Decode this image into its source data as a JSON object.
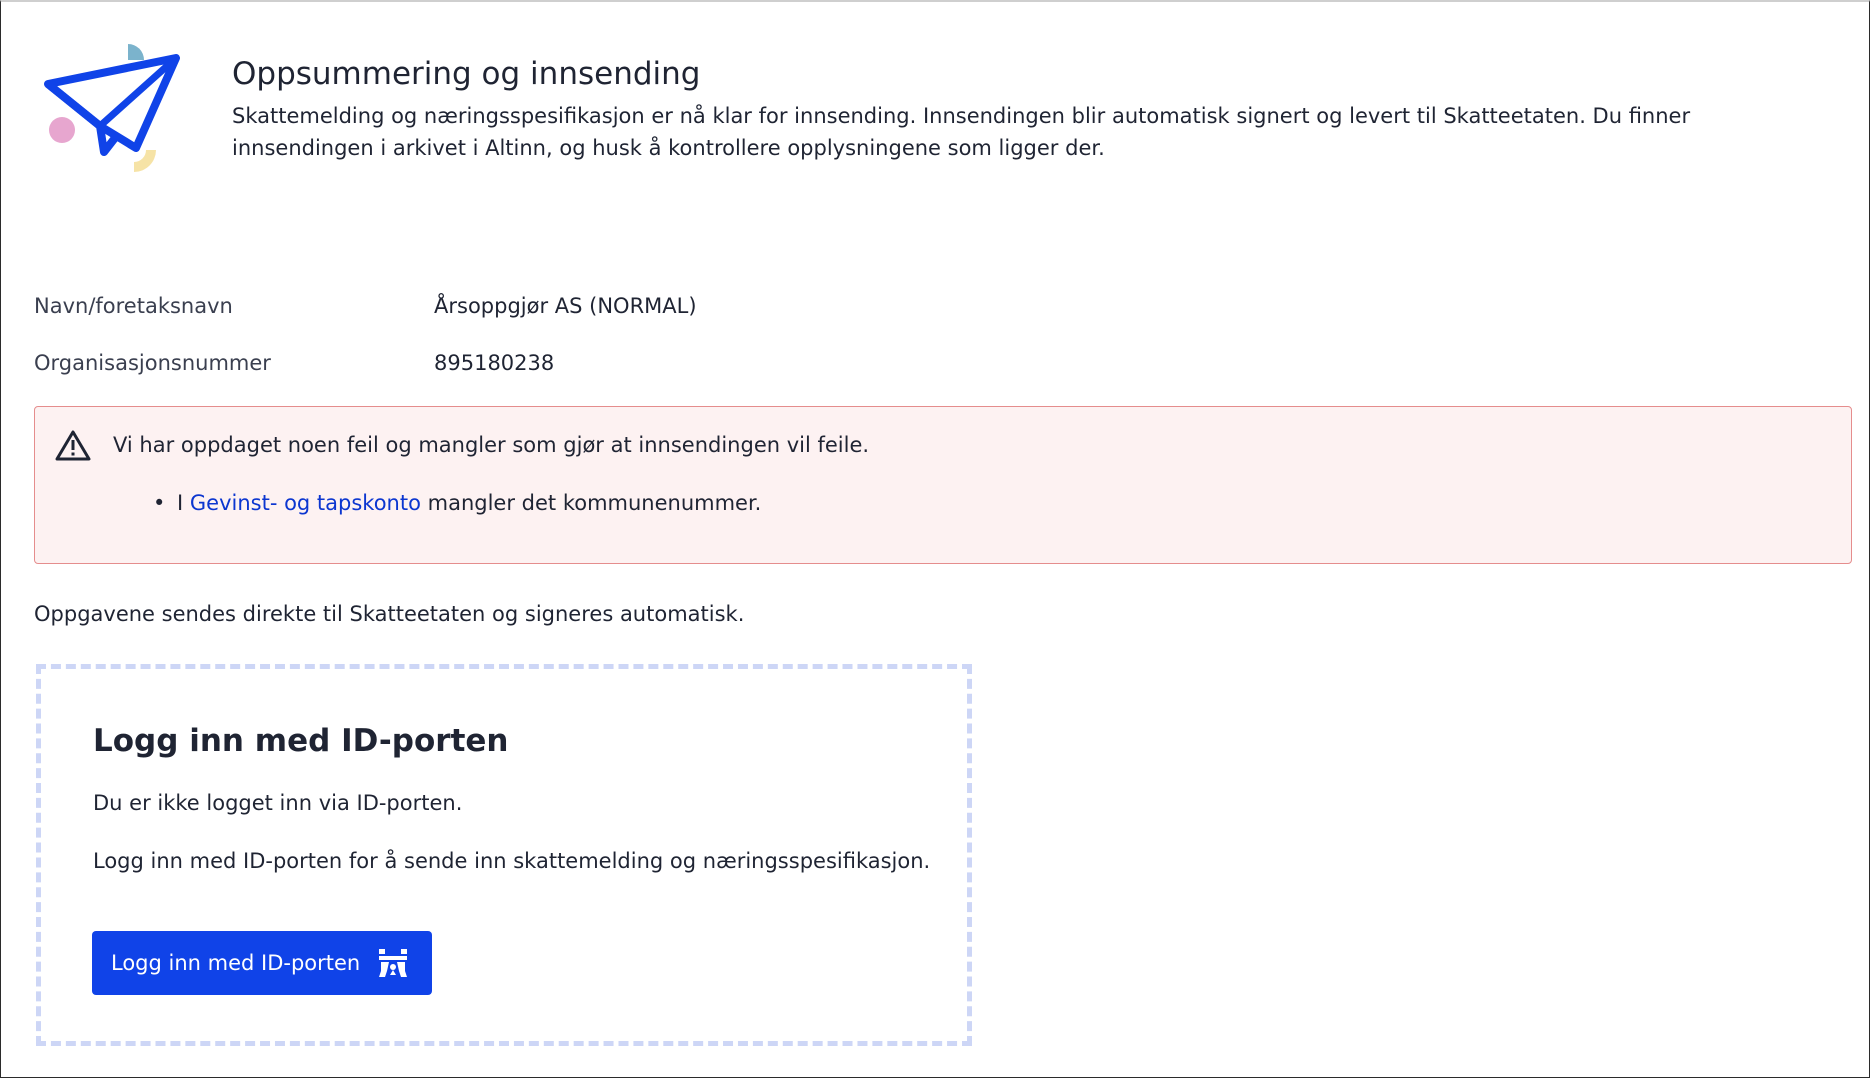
{
  "header": {
    "title": "Oppsummering og innsending",
    "intro": "Skattemelding og næringsspesifikasjon er nå klar for innsending. Innsendingen blir automatisk signert og levert til Skatteetaten. Du finner innsendingen i arkivet i Altinn, og husk å kontrollere opplysningene som ligger der.",
    "icon": "paper-plane-icon"
  },
  "info": {
    "name_label": "Navn/foretaksnavn",
    "name_value": "Årsoppgjør AS (NORMAL)",
    "orgnr_label": "Organisasjonsnummer",
    "orgnr_value": "895180238"
  },
  "alert": {
    "icon": "warning-icon",
    "message": "Vi har oppdaget noen feil og mangler som gjør at innsendingen vil feile.",
    "items": [
      {
        "prefix": "I ",
        "link": "Gevinst- og tapskonto",
        "suffix": " mangler det kommunenummer."
      }
    ],
    "colors": {
      "background": "#fdf2f2",
      "border": "#e58d8d",
      "link": "#0c36d0"
    }
  },
  "note": "Oppgavene sendes direkte til Skatteetaten og signeres automatisk.",
  "login": {
    "title": "Logg inn med ID-porten",
    "p1": "Du er ikke logget inn via ID-porten.",
    "p2": "Logg inn med ID-porten for å sende inn skattemelding og næringsspesifikasjon.",
    "button_label": "Logg inn med ID-porten",
    "button_icon": "id-porten-icon",
    "colors": {
      "button": "#1043e8",
      "border": "#cdd6f6"
    }
  }
}
